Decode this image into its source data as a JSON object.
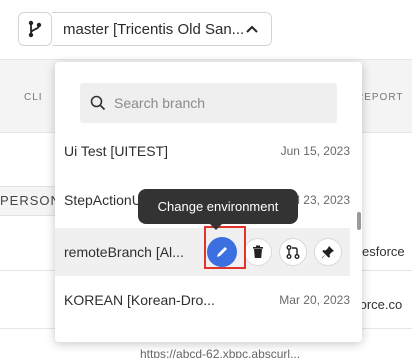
{
  "header": {
    "branch_icon": "branch-icon",
    "current_branch": "master [Tricentis Old San...",
    "chevron_icon": "chevron-up-icon"
  },
  "background": {
    "col_left": "CLI",
    "col_right": "REPORT",
    "person": "PERSON",
    "salesforce_1": "esforce",
    "salesforce_2": "force.co",
    "bottom_text": "https://abcd-62.xbpc.abscurl..."
  },
  "dropdown": {
    "search_placeholder": "Search branch",
    "items": [
      {
        "name": "Ui Test [UITEST]",
        "date": "Jun 15, 2023"
      },
      {
        "name": "StepActionUpdates [Pr...",
        "date": "Jul 23, 2023"
      },
      {
        "name": "remoteBranch [Al...",
        "date": ""
      },
      {
        "name": "KOREAN [Korean-Dro...",
        "date": "Mar 20, 2023"
      }
    ],
    "tooltip": "Change environment",
    "actions": [
      {
        "icon": "edit-icon"
      },
      {
        "icon": "trash-icon"
      },
      {
        "icon": "merge-icon"
      },
      {
        "icon": "pin-icon"
      }
    ]
  },
  "colors": {
    "primary": "#3c6fe0",
    "highlight": "#e0352b",
    "tooltip_bg": "#333333"
  }
}
